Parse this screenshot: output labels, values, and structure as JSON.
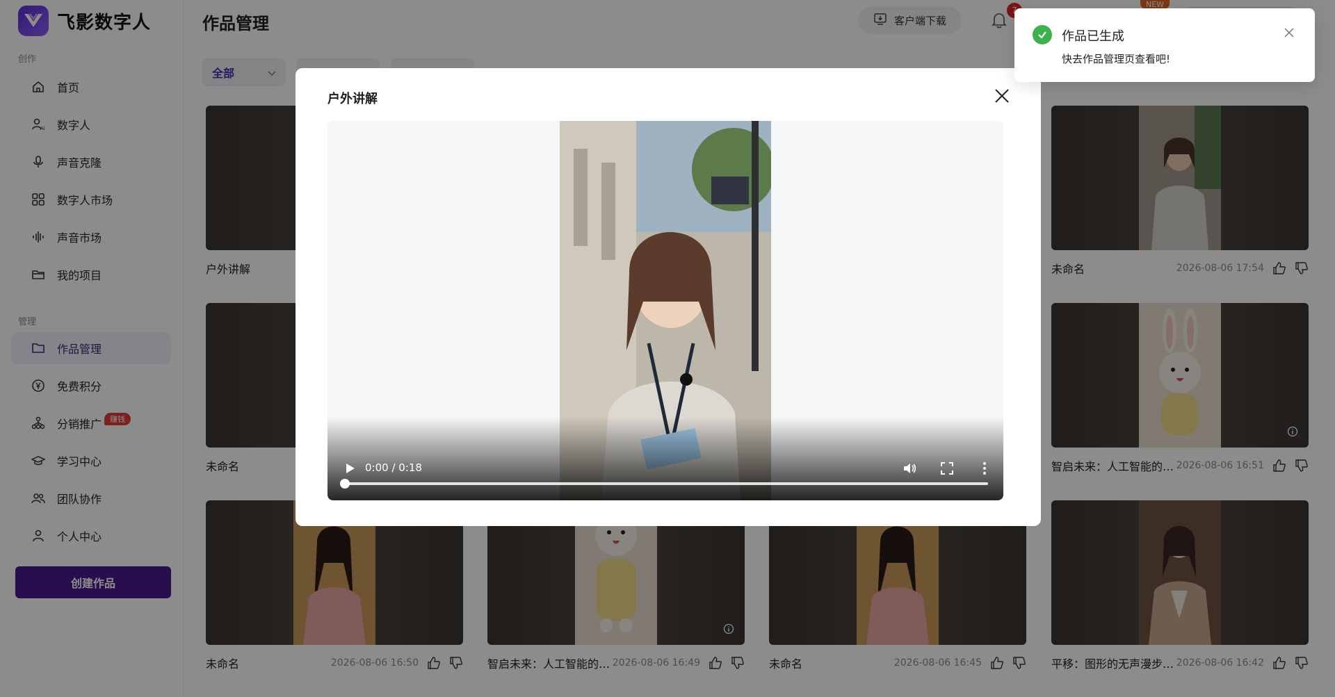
{
  "app": {
    "name": "飞影数字人"
  },
  "sidebar": {
    "sections": [
      {
        "label": "创作"
      },
      {
        "label": "管理"
      }
    ],
    "items": [
      {
        "label": "首页",
        "icon": "home-icon"
      },
      {
        "label": "数字人",
        "icon": "avatar-icon"
      },
      {
        "label": "声音克隆",
        "icon": "microphone-icon"
      },
      {
        "label": "数字人市场",
        "icon": "grid-icon"
      },
      {
        "label": "声音市场",
        "icon": "waveform-icon"
      },
      {
        "label": "我的项目",
        "icon": "folder-icon"
      },
      {
        "label": "作品管理",
        "icon": "folder-icon",
        "active": true
      },
      {
        "label": "免费积分",
        "icon": "yen-coin-icon"
      },
      {
        "label": "分销推广",
        "icon": "network-icon",
        "badge": "赚钱"
      },
      {
        "label": "学习中心",
        "icon": "graduation-cap-icon"
      },
      {
        "label": "团队协作",
        "icon": "team-icon"
      },
      {
        "label": "个人中心",
        "icon": "user-icon"
      }
    ],
    "create_button": "创建作品"
  },
  "header": {
    "title": "作品管理",
    "download_label": "客户端下载",
    "notification_count": "7",
    "new_tag": "NEW"
  },
  "filters": {
    "all_label": "全部"
  },
  "cards": [
    {
      "title": "户外讲解",
      "date": ""
    },
    {
      "title": "未命名",
      "date": "2026-08-06 17:54"
    },
    {
      "title": "未命名",
      "date": ""
    },
    {
      "title": "智启未来：人工智能的变...",
      "date": "2026-08-06 16:51"
    },
    {
      "title": "未命名",
      "date": "2026-08-06 16:50"
    },
    {
      "title": "智启未来：人工智能的变...",
      "date": "2026-08-06 16:49"
    },
    {
      "title": "未命名",
      "date": "2026-08-06 16:45"
    },
    {
      "title": "平移：图形的无声漫步.pdf",
      "date": "2026-08-06 16:42"
    }
  ],
  "modal": {
    "title": "户外讲解",
    "video": {
      "time": "0:00 / 0:18",
      "progress": 0.0
    }
  },
  "toast": {
    "title": "作品已生成",
    "message": "快去作品管理页查看吧!"
  },
  "colors": {
    "accent": "#4a1a8f",
    "success": "#3cb34a",
    "badge": "#e23b3b"
  }
}
